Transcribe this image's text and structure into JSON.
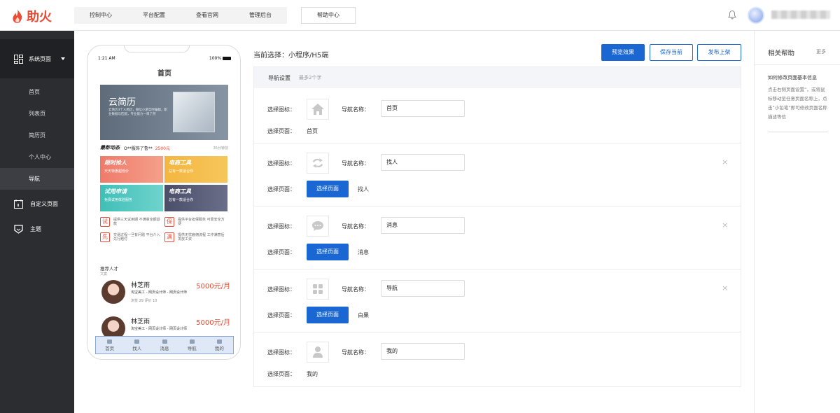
{
  "brand": {
    "name": "助火",
    "color": "#e94b35"
  },
  "topnav": {
    "items": [
      "控制中心",
      "平台配置",
      "查看官网",
      "管理后台"
    ],
    "help": "帮助中心"
  },
  "sidebar": {
    "group": "系统页面",
    "subs": [
      "首页",
      "列表页",
      "简历页",
      "个人中心",
      "导航"
    ],
    "active": "导航",
    "items": [
      "自定义页面",
      "主题"
    ]
  },
  "phone": {
    "time": "1:21 AM",
    "battery": "100%",
    "title": "首页",
    "banner": {
      "title": "云简历",
      "sub": "云简历3个人简历，微信小游实时编辑，职业数据与匹配，专业能力一目了然"
    },
    "news": {
      "label": "最新动态",
      "text": "O**服饰了鲁**",
      "price": "2500元",
      "time": "35分钟前"
    },
    "cards": [
      {
        "t": "限时抢人",
        "s": "天天特惠超低价"
      },
      {
        "t": "电商工具",
        "s": "总有一款适合你"
      },
      {
        "t": "试用申请",
        "s": "免费试用体验服务"
      },
      {
        "t": "电商工具",
        "s": "总有一款适合你"
      }
    ],
    "features": [
      {
        "b": "试",
        "t": "提供三天试用期 不满意全额退款"
      },
      {
        "b": "保",
        "t": "提供平台担保服务 可靠安全方便"
      },
      {
        "b": "先",
        "t": "交易过程一旦有问题 平台介入先行赔付"
      },
      {
        "b": "满",
        "t": "提供无忧雇佣流程 工作满意后发放工资"
      }
    ],
    "rec": {
      "title": "推荐人才",
      "sub": "文案"
    },
    "people": [
      {
        "name": "林芝雨",
        "salary": "5000元/月",
        "desc": "淘宝美工 - 网页设计师 - 网页设计师",
        "meta": "浏览 29  评价 10"
      },
      {
        "name": "林芝雨",
        "salary": "5000元/月",
        "desc": "淘宝美工 - 网页设计师 - 网页设计师",
        "meta": ""
      }
    ],
    "tabs": [
      "首页",
      "找人",
      "消息",
      "导航",
      "我的"
    ]
  },
  "editor": {
    "current": "当前选择：小程序/H5端",
    "buttons": {
      "preview": "预览效果",
      "save": "保存当前",
      "publish": "发布上架"
    },
    "header": "导航设置",
    "hint": "最多2个字",
    "labels": {
      "icon": "选择图标：",
      "name": "导航名称：",
      "page": "选择页面："
    },
    "select_btn": "选择页面",
    "rows": [
      {
        "name": "首页",
        "page": "首页",
        "icon": "home-icon"
      },
      {
        "name": "找人",
        "page": "找人",
        "icon": "swap-icon"
      },
      {
        "name": "消息",
        "page": "消息",
        "icon": "chat-icon"
      },
      {
        "name": "导航",
        "page": "白果",
        "icon": "grid-icon"
      },
      {
        "name": "我的",
        "page": "我的",
        "icon": "user-icon"
      }
    ],
    "close": "×"
  },
  "help": {
    "title": "相关帮助",
    "more": "更多",
    "q": "如何修改页面基本信息",
    "a": "点击右侧页面设置”，或将鼠标移动至任意页面名称上，点击“小铅笔”即可修改页面名称描述等信"
  }
}
